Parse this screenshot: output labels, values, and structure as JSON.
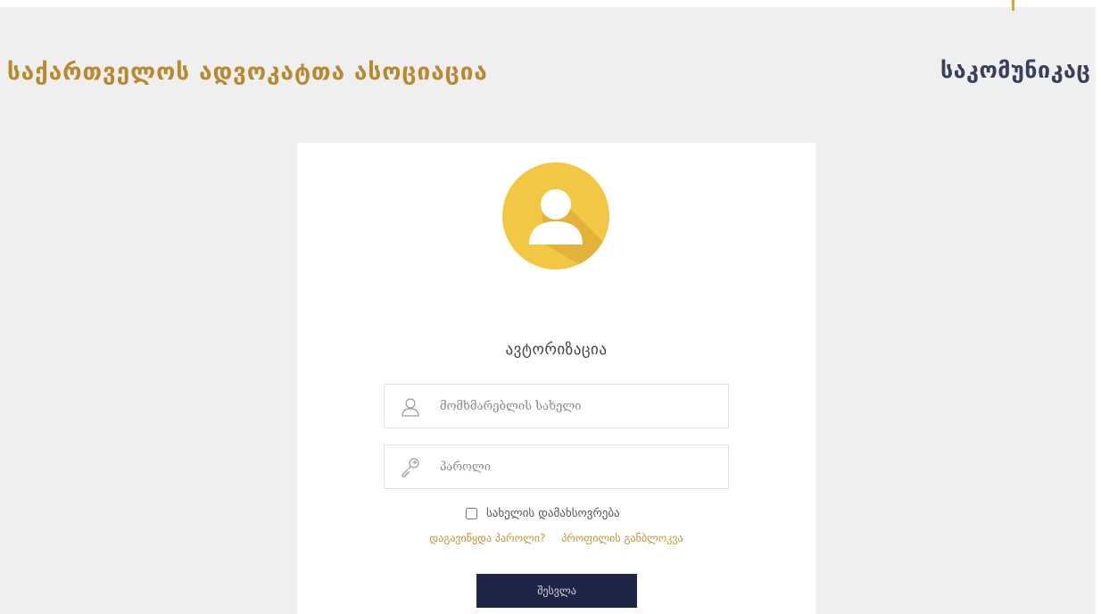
{
  "header": {
    "title_left": "საქართველოს ადვოკატთა ასოციაცია",
    "title_right": "საკომუნიკაც"
  },
  "login": {
    "title": "ავტორიზაცია",
    "username_placeholder": "მომხმარებლის სახელი",
    "password_placeholder": "პაროლი",
    "remember_label": "სახელის დამახსოვრება",
    "forgot_password_link": "დაგავიწყდა პაროლი?",
    "unlock_profile_link": "პროფილის განბლოკვა",
    "submit_label": "შესვლა"
  },
  "icons": {
    "avatar": "user-avatar-icon",
    "username": "user-icon",
    "password": "key-icon"
  },
  "colors": {
    "background": "#efefef",
    "header_gold": "#b8892e",
    "header_navy": "#3a3f5c",
    "avatar_yellow": "#f2c744",
    "link_gold": "#c4932f",
    "button_navy": "#1f2547"
  }
}
